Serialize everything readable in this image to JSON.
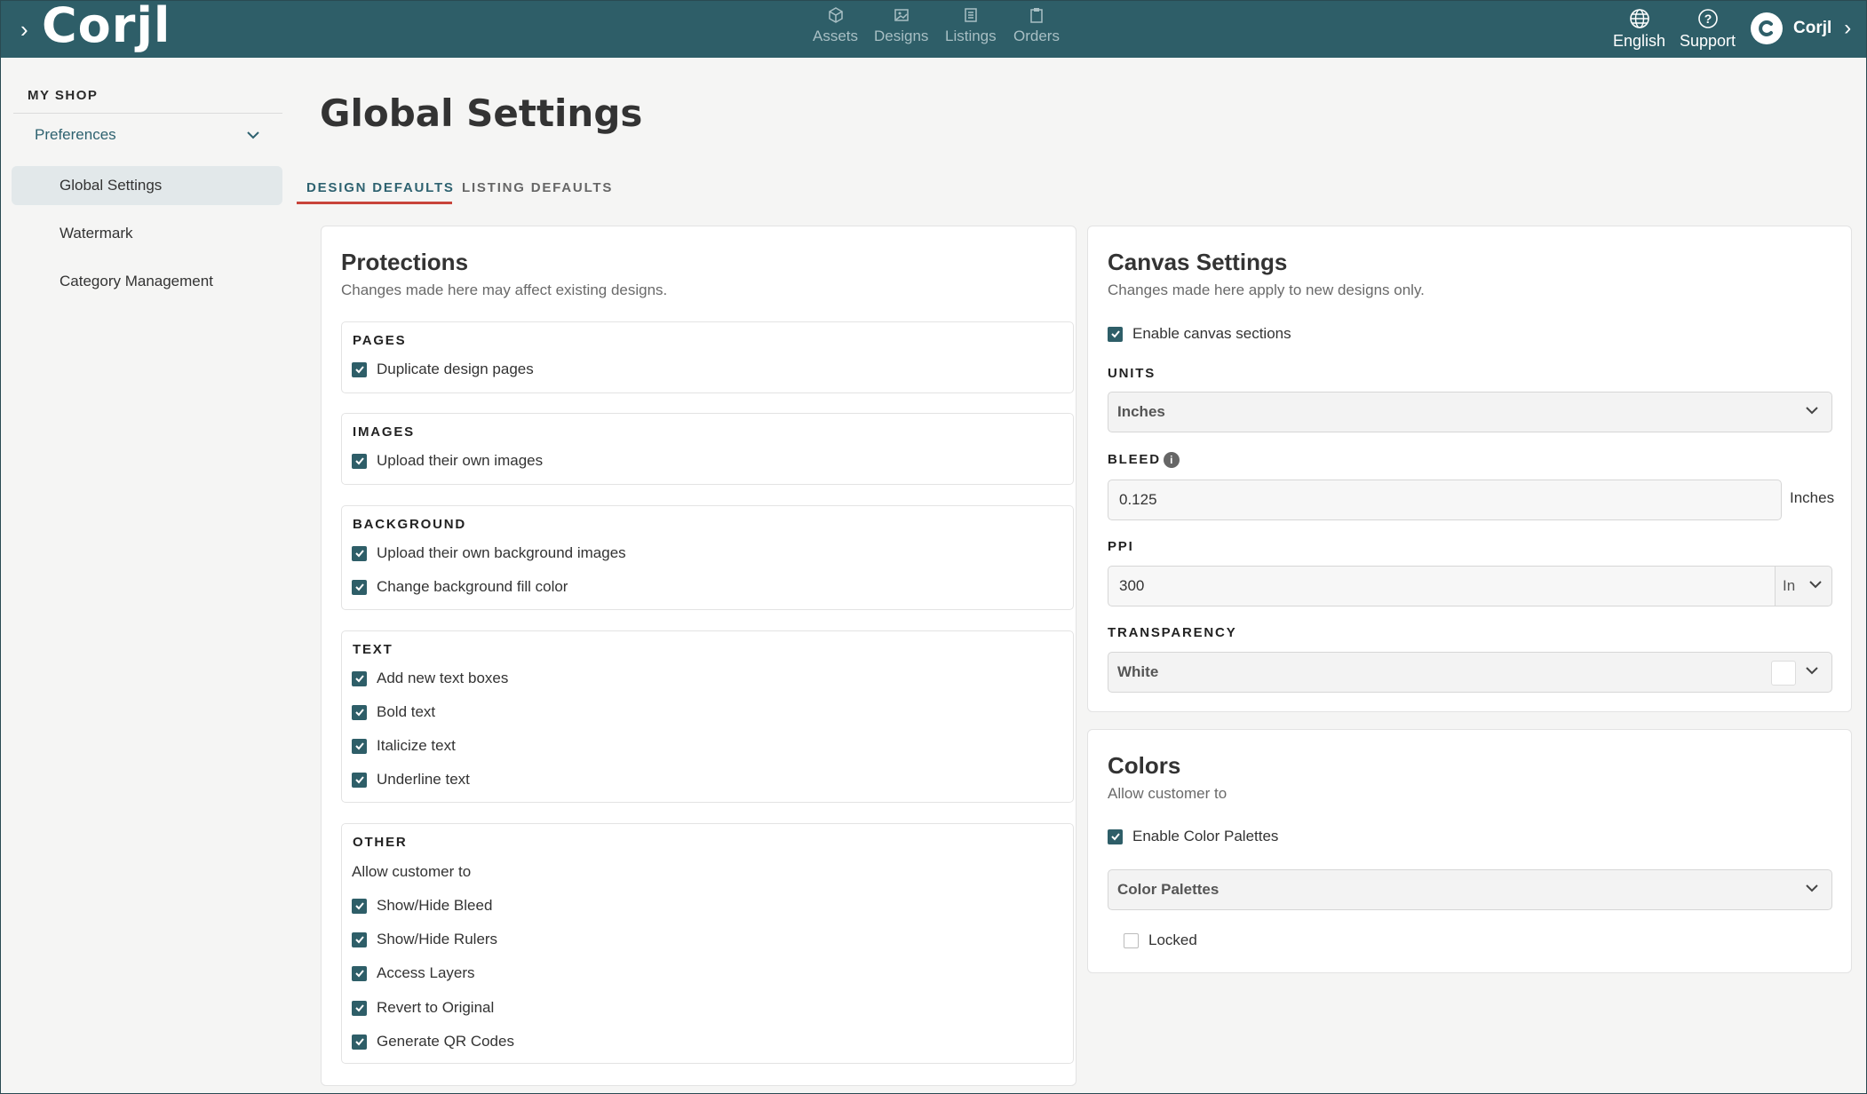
{
  "topbar": {
    "logo": "Corjl",
    "nav": [
      {
        "label": "Assets",
        "icon": "box-icon"
      },
      {
        "label": "Designs",
        "icon": "image-icon"
      },
      {
        "label": "Listings",
        "icon": "list-icon"
      },
      {
        "label": "Orders",
        "icon": "clipboard-icon"
      }
    ],
    "language": "English",
    "support": "Support",
    "account": "Corjl"
  },
  "sidebar": {
    "heading": "MY SHOP",
    "group": "Preferences",
    "items": [
      "Global Settings",
      "Watermark",
      "Category Management"
    ]
  },
  "main": {
    "title": "Global Settings",
    "tabs": [
      "DESIGN DEFAULTS",
      "LISTING DEFAULTS"
    ]
  },
  "protections": {
    "title": "Protections",
    "subtitle": "Changes made here may affect existing designs.",
    "pages": {
      "title": "PAGES",
      "items": [
        "Duplicate design pages"
      ]
    },
    "images": {
      "title": "IMAGES",
      "items": [
        "Upload their own images"
      ]
    },
    "background": {
      "title": "BACKGROUND",
      "items": [
        "Upload their own background images",
        "Change background fill color"
      ]
    },
    "text": {
      "title": "TEXT",
      "items": [
        "Add new text boxes",
        "Bold text",
        "Italicize text",
        "Underline text"
      ]
    },
    "other": {
      "title": "OTHER",
      "allow": "Allow customer to",
      "items": [
        "Show/Hide Bleed",
        "Show/Hide Rulers",
        "Access Layers",
        "Revert to Original",
        "Generate QR Codes"
      ]
    }
  },
  "canvas": {
    "title": "Canvas Settings",
    "subtitle": "Changes made here apply to new designs only.",
    "enable_sections": "Enable canvas sections",
    "units_label": "UNITS",
    "units_value": "Inches",
    "bleed_label": "BLEED",
    "bleed_value": "0.125",
    "bleed_unit": "Inches",
    "ppi_label": "PPI",
    "ppi_value": "300",
    "ppi_unit": "In",
    "transparency_label": "TRANSPARENCY",
    "transparency_value": "White"
  },
  "colors": {
    "title": "Colors",
    "subtitle": "Allow customer to",
    "enable_palettes": "Enable Color Palettes",
    "palettes_select": "Color Palettes",
    "locked": "Locked"
  },
  "colors_theme": {
    "primary": "#2e5e68",
    "accent": "#c8443b"
  }
}
